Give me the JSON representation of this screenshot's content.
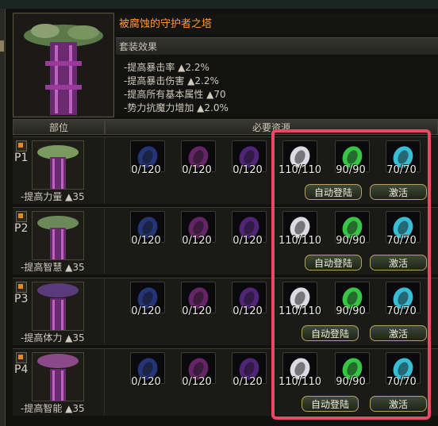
{
  "set": {
    "name": "被腐蚀的守护者之塔",
    "effect_label": "套装效果",
    "effects": [
      "-提高暴击率 ▲2.2%",
      "-提高暴击伤害 ▲2.2%",
      "-提高所有基本属性 ▲70",
      "-势力抗魔力增加 ▲2.0%"
    ]
  },
  "headers": {
    "part": "部位",
    "resources": "必要资源"
  },
  "rows": [
    {
      "label": "P1",
      "bonus": "-提高力量 ▲35",
      "counts": [
        "0/120",
        "0/120",
        "0/120",
        "110/110",
        "90/90",
        "70/70"
      ],
      "auto": "自动登陆",
      "activate": "激活"
    },
    {
      "label": "P2",
      "bonus": "-提高智慧 ▲35",
      "counts": [
        "0/120",
        "0/120",
        "0/120",
        "110/110",
        "90/90",
        "70/70"
      ],
      "auto": "自动登陆",
      "activate": "激活"
    },
    {
      "label": "P3",
      "bonus": "-提高体力 ▲35",
      "counts": [
        "0/120",
        "0/120",
        "0/120",
        "110/110",
        "90/90",
        "70/70"
      ],
      "auto": "自动登陆",
      "activate": "激活"
    },
    {
      "label": "P4",
      "bonus": "-提高智能 ▲35",
      "counts": [
        "0/120",
        "0/120",
        "0/120",
        "110/110",
        "90/90",
        "70/70"
      ],
      "auto": "自动登陆",
      "activate": "激活"
    }
  ],
  "slot_colors": [
    "#3a5ad0",
    "#b03ab0",
    "#8a3ad0",
    "#e8e8f0",
    "#3ad04a",
    "#3ac8e0"
  ],
  "colors": {
    "title": "#ff9a3a",
    "highlight": "#e84a64",
    "checkbox": "#e28a20"
  }
}
